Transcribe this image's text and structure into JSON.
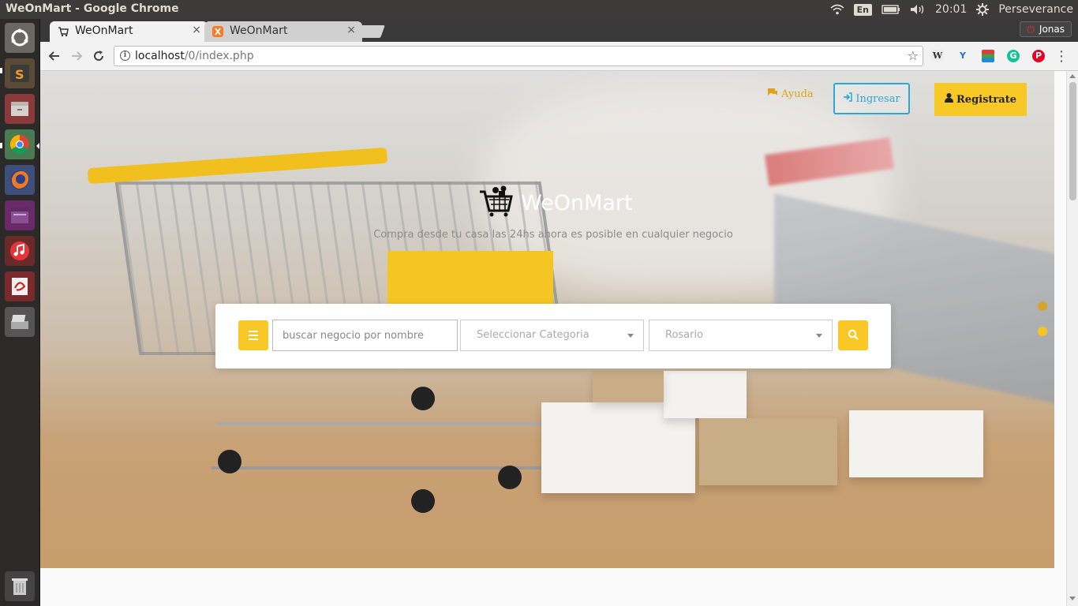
{
  "window": {
    "title": "WeOnMart - Google Chrome"
  },
  "panel": {
    "language": "En",
    "time": "20:01",
    "user": "Perseverance"
  },
  "browser": {
    "tabs": [
      {
        "label": "WeOnMart",
        "close": "×"
      },
      {
        "label": "WeOnMart",
        "close": "×"
      }
    ],
    "profile": "Jonas",
    "url_host": "localhost",
    "url_path": "/0/index.php"
  },
  "page": {
    "help_label": "Ayuda",
    "login_label": "Ingresar",
    "signup_label": "Registrate",
    "brand": "WeOnMart",
    "tagline": "Compra desde tu casa las 24hs ahora es posible en cualquier negocio",
    "search": {
      "placeholder": "buscar negocio por nombre",
      "category": "Seleccionar Categoria",
      "city": "Rosario"
    }
  },
  "colors": {
    "accent": "#f8c826",
    "login": "#2fa6d8",
    "help": "#e0a21a"
  }
}
